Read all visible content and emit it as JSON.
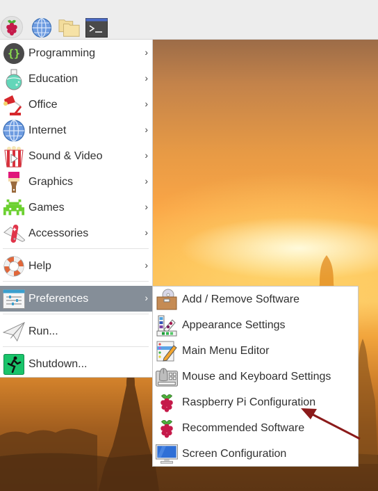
{
  "panel": {
    "launchers": [
      {
        "name": "menu-button",
        "icon": "raspberry-icon"
      },
      {
        "name": "web-browser-launcher",
        "icon": "globe-icon"
      },
      {
        "name": "file-manager-launcher",
        "icon": "folder-icon"
      },
      {
        "name": "terminal-launcher",
        "icon": "terminal-icon"
      }
    ]
  },
  "main_menu": {
    "items": [
      {
        "label": "Programming",
        "icon": "programming-braces-icon",
        "has_submenu": true
      },
      {
        "label": "Education",
        "icon": "flask-icon",
        "has_submenu": true
      },
      {
        "label": "Office",
        "icon": "desk-lamp-icon",
        "has_submenu": true
      },
      {
        "label": "Internet",
        "icon": "globe-icon",
        "has_submenu": true
      },
      {
        "label": "Sound & Video",
        "icon": "popcorn-play-icon",
        "has_submenu": true
      },
      {
        "label": "Graphics",
        "icon": "paintbrush-icon",
        "has_submenu": true
      },
      {
        "label": "Games",
        "icon": "space-invader-icon",
        "has_submenu": true
      },
      {
        "label": "Accessories",
        "icon": "pocket-knife-icon",
        "has_submenu": true
      },
      {
        "label": "Help",
        "icon": "lifebuoy-icon",
        "has_submenu": true
      },
      {
        "label": "Preferences",
        "icon": "preferences-sliders-icon",
        "has_submenu": true,
        "active": true
      },
      {
        "label": "Run...",
        "icon": "paper-plane-icon",
        "has_submenu": false
      },
      {
        "label": "Shutdown...",
        "icon": "running-exit-icon",
        "has_submenu": false
      }
    ],
    "chevron": "›"
  },
  "preferences_submenu": {
    "items": [
      {
        "label": "Add / Remove Software",
        "icon": "software-box-icon"
      },
      {
        "label": "Appearance Settings",
        "icon": "color-swatch-icon"
      },
      {
        "label": "Main Menu Editor",
        "icon": "menu-editor-pencil-icon"
      },
      {
        "label": "Mouse and Keyboard Settings",
        "icon": "mouse-keyboard-icon"
      },
      {
        "label": "Raspberry Pi Configuration",
        "icon": "raspberry-icon",
        "highlighted_by_annotation": true
      },
      {
        "label": "Recommended Software",
        "icon": "raspberry-icon"
      },
      {
        "label": "Screen Configuration",
        "icon": "monitor-icon"
      }
    ]
  },
  "annotation": {
    "type": "arrow",
    "points_to": "Raspberry Pi Configuration",
    "color": "#8b1a1a"
  },
  "colors": {
    "active_item_bg": "#858e98",
    "menu_bg": "#ffffff",
    "panel_bg": "#ededed"
  }
}
